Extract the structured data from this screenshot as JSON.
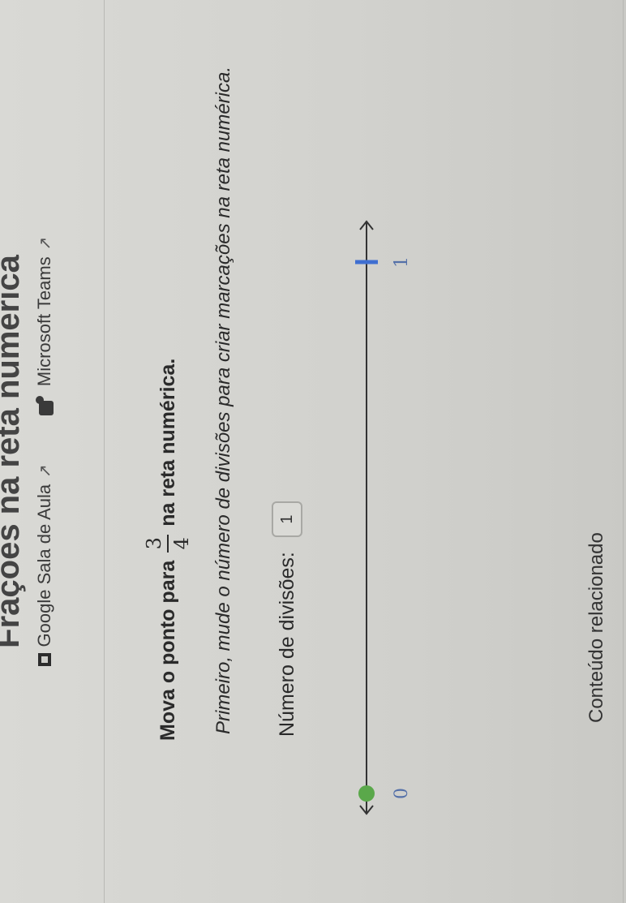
{
  "page": {
    "title": "Frações na reta numérica"
  },
  "share": {
    "google_classroom": "Google Sala de Aula",
    "microsoft_teams": "Microsoft Teams"
  },
  "prompt": {
    "before": "Mova o ponto para",
    "numerator": "3",
    "denominator": "4",
    "after": "na reta numérica."
  },
  "instruction": "Primeiro, mude o número de divisões para criar marcações na reta numérica.",
  "divisions": {
    "label": "Número de divisões:",
    "value": "1"
  },
  "number_line": {
    "start_label": "0",
    "end_label": "1",
    "point_value": 0,
    "point_color": "#5aa84a",
    "end_tick_color": "#3f6fd1"
  },
  "related": {
    "label": "Conteúdo relacionado"
  }
}
